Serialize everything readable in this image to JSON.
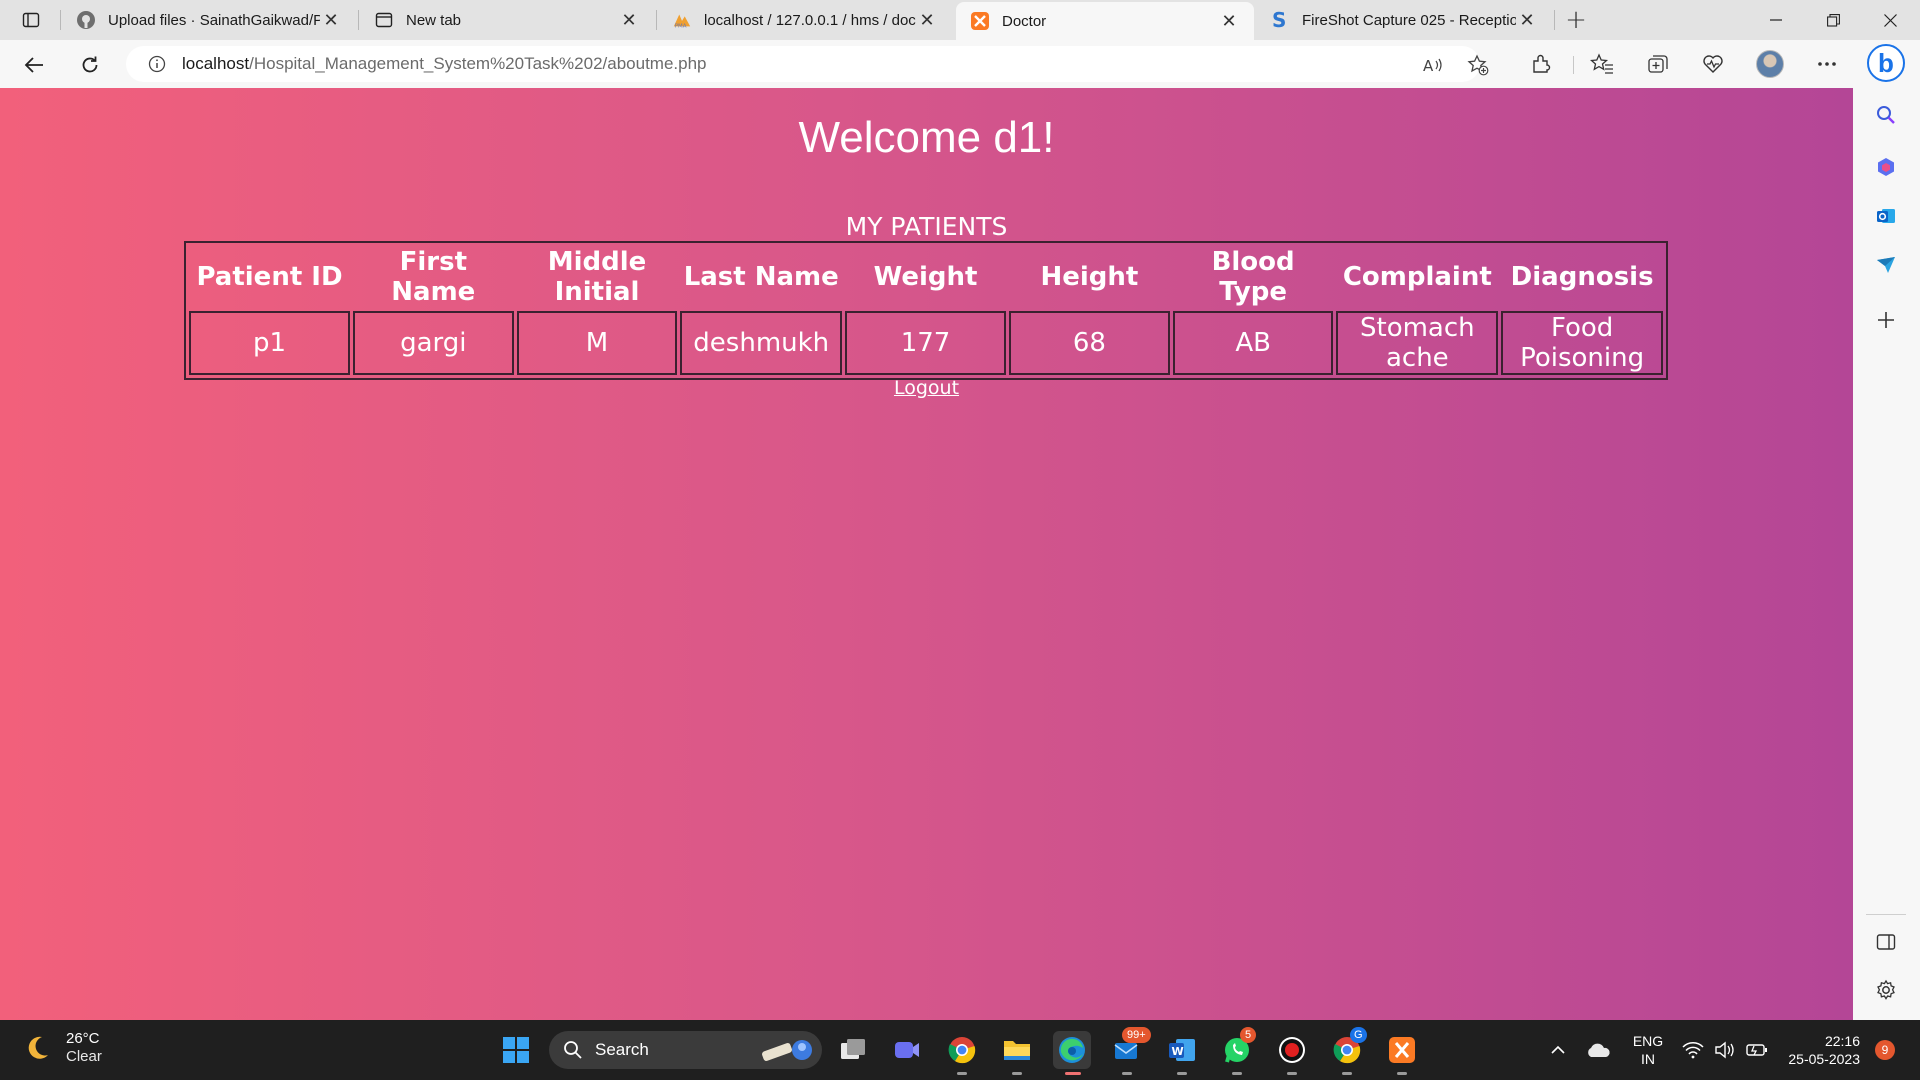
{
  "browser": {
    "tabs": [
      {
        "title": "Upload files · SainathGaikwad/Pr",
        "icon": "github-icon"
      },
      {
        "title": "New tab",
        "icon": "newtab-icon"
      },
      {
        "title": "localhost / 127.0.0.1 / hms / doct",
        "icon": "phpmyadmin-icon"
      },
      {
        "title": "Doctor",
        "icon": "xampp-icon",
        "active": true
      },
      {
        "title": "FireShot Capture 025 - Receptior",
        "icon": "fireshot-icon"
      }
    ],
    "url_host": "localhost",
    "url_path": "/Hospital_Management_System%20Task%202/aboutme.php"
  },
  "page": {
    "welcome": "Welcome d1!",
    "caption": "MY PATIENTS",
    "columns": [
      "Patient ID",
      "First Name",
      "Middle Initial",
      "Last Name",
      "Weight",
      "Height",
      "Blood Type",
      "Complaint",
      "Diagnosis"
    ],
    "rows": [
      [
        "p1",
        "gargi",
        "M",
        "deshmukh",
        "177",
        "68",
        "AB",
        "Stomach ache",
        "Food Poisoning"
      ]
    ],
    "logout": "Logout"
  },
  "taskbar": {
    "temperature": "26°C",
    "condition": "Clear",
    "search_label": "Search",
    "mail_badge": "99+",
    "whatsapp_badge": "5",
    "chrome_badge": "G",
    "lang_top": "ENG",
    "lang_bottom": "IN",
    "time": "22:16",
    "date": "25-05-2023",
    "notification_count": "9"
  },
  "colors": {
    "page_gradient_start": "#f2607b",
    "page_gradient_end": "#b44696",
    "table_border": "#3b2130"
  }
}
